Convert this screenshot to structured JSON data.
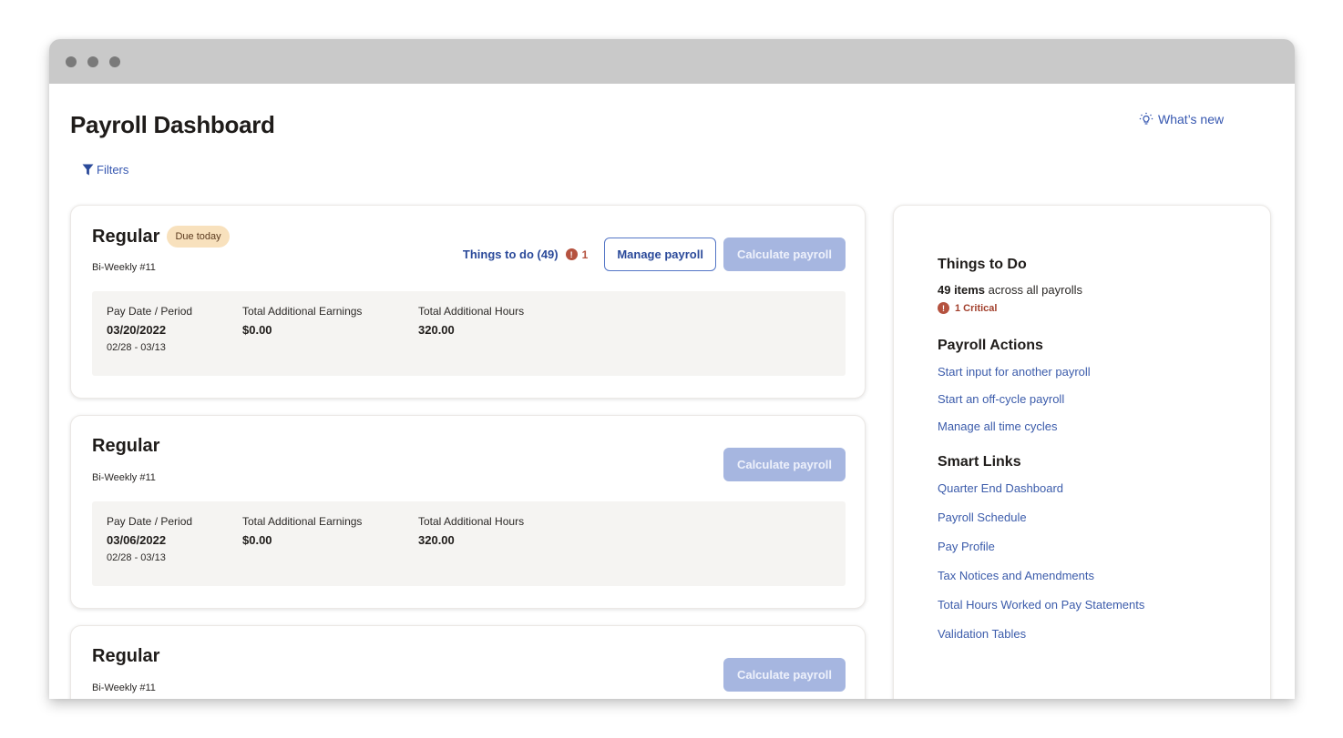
{
  "window": {
    "controls": [
      "close-dot",
      "minimize-dot",
      "maximize-dot"
    ]
  },
  "header": {
    "title": "Payroll Dashboard",
    "whats_new": "What’s new",
    "whats_new_icon": "lightbulb-icon",
    "filters": "Filters",
    "filters_icon": "funnel-icon"
  },
  "payrolls": [
    {
      "title": "Regular",
      "badge": "Due today",
      "subtitle": "Bi-Weekly #11",
      "things_to_do": "Things to do (49)",
      "critical_count": "1",
      "manage_label": "Manage payroll",
      "calculate_label": "Calculate payroll",
      "labels": {
        "pay_date": "Pay Date / Period",
        "earnings": "Total Additional Earnings",
        "hours": "Total Additional Hours"
      },
      "pay_date": "03/20/2022",
      "period": "02/28 - 03/13",
      "earnings": "$0.00",
      "hours": "320.00"
    },
    {
      "title": "Regular",
      "subtitle": "Bi-Weekly #11",
      "calculate_label": "Calculate payroll",
      "labels": {
        "pay_date": "Pay Date / Period",
        "earnings": "Total Additional Earnings",
        "hours": "Total Additional Hours"
      },
      "pay_date": "03/06/2022",
      "period": "02/28 - 03/13",
      "earnings": "$0.00",
      "hours": "320.00"
    },
    {
      "title": "Regular",
      "subtitle": "Bi-Weekly #11",
      "calculate_label": "Calculate payroll"
    }
  ],
  "sidebar": {
    "things_to_do": {
      "heading": "Things to Do",
      "count_bold": "49 items",
      "count_rest": " across all payrolls",
      "critical": "1 Critical"
    },
    "payroll_actions": {
      "heading": "Payroll Actions",
      "links": [
        "Start input for another payroll",
        "Start an off-cycle payroll",
        "Manage all time cycles"
      ]
    },
    "smart_links": {
      "heading": "Smart Links",
      "links": [
        "Quarter End Dashboard",
        "Payroll Schedule",
        "Pay Profile",
        "Tax Notices and Amendments",
        "Total Hours Worked on Pay Statements",
        "Validation Tables"
      ]
    }
  },
  "colors": {
    "link": "#3657b0",
    "critical": "#b5523f",
    "badge_bg": "#f8e1bd",
    "button_disabled": "#a6b6e0",
    "titlebar": "#c9c9c9"
  }
}
